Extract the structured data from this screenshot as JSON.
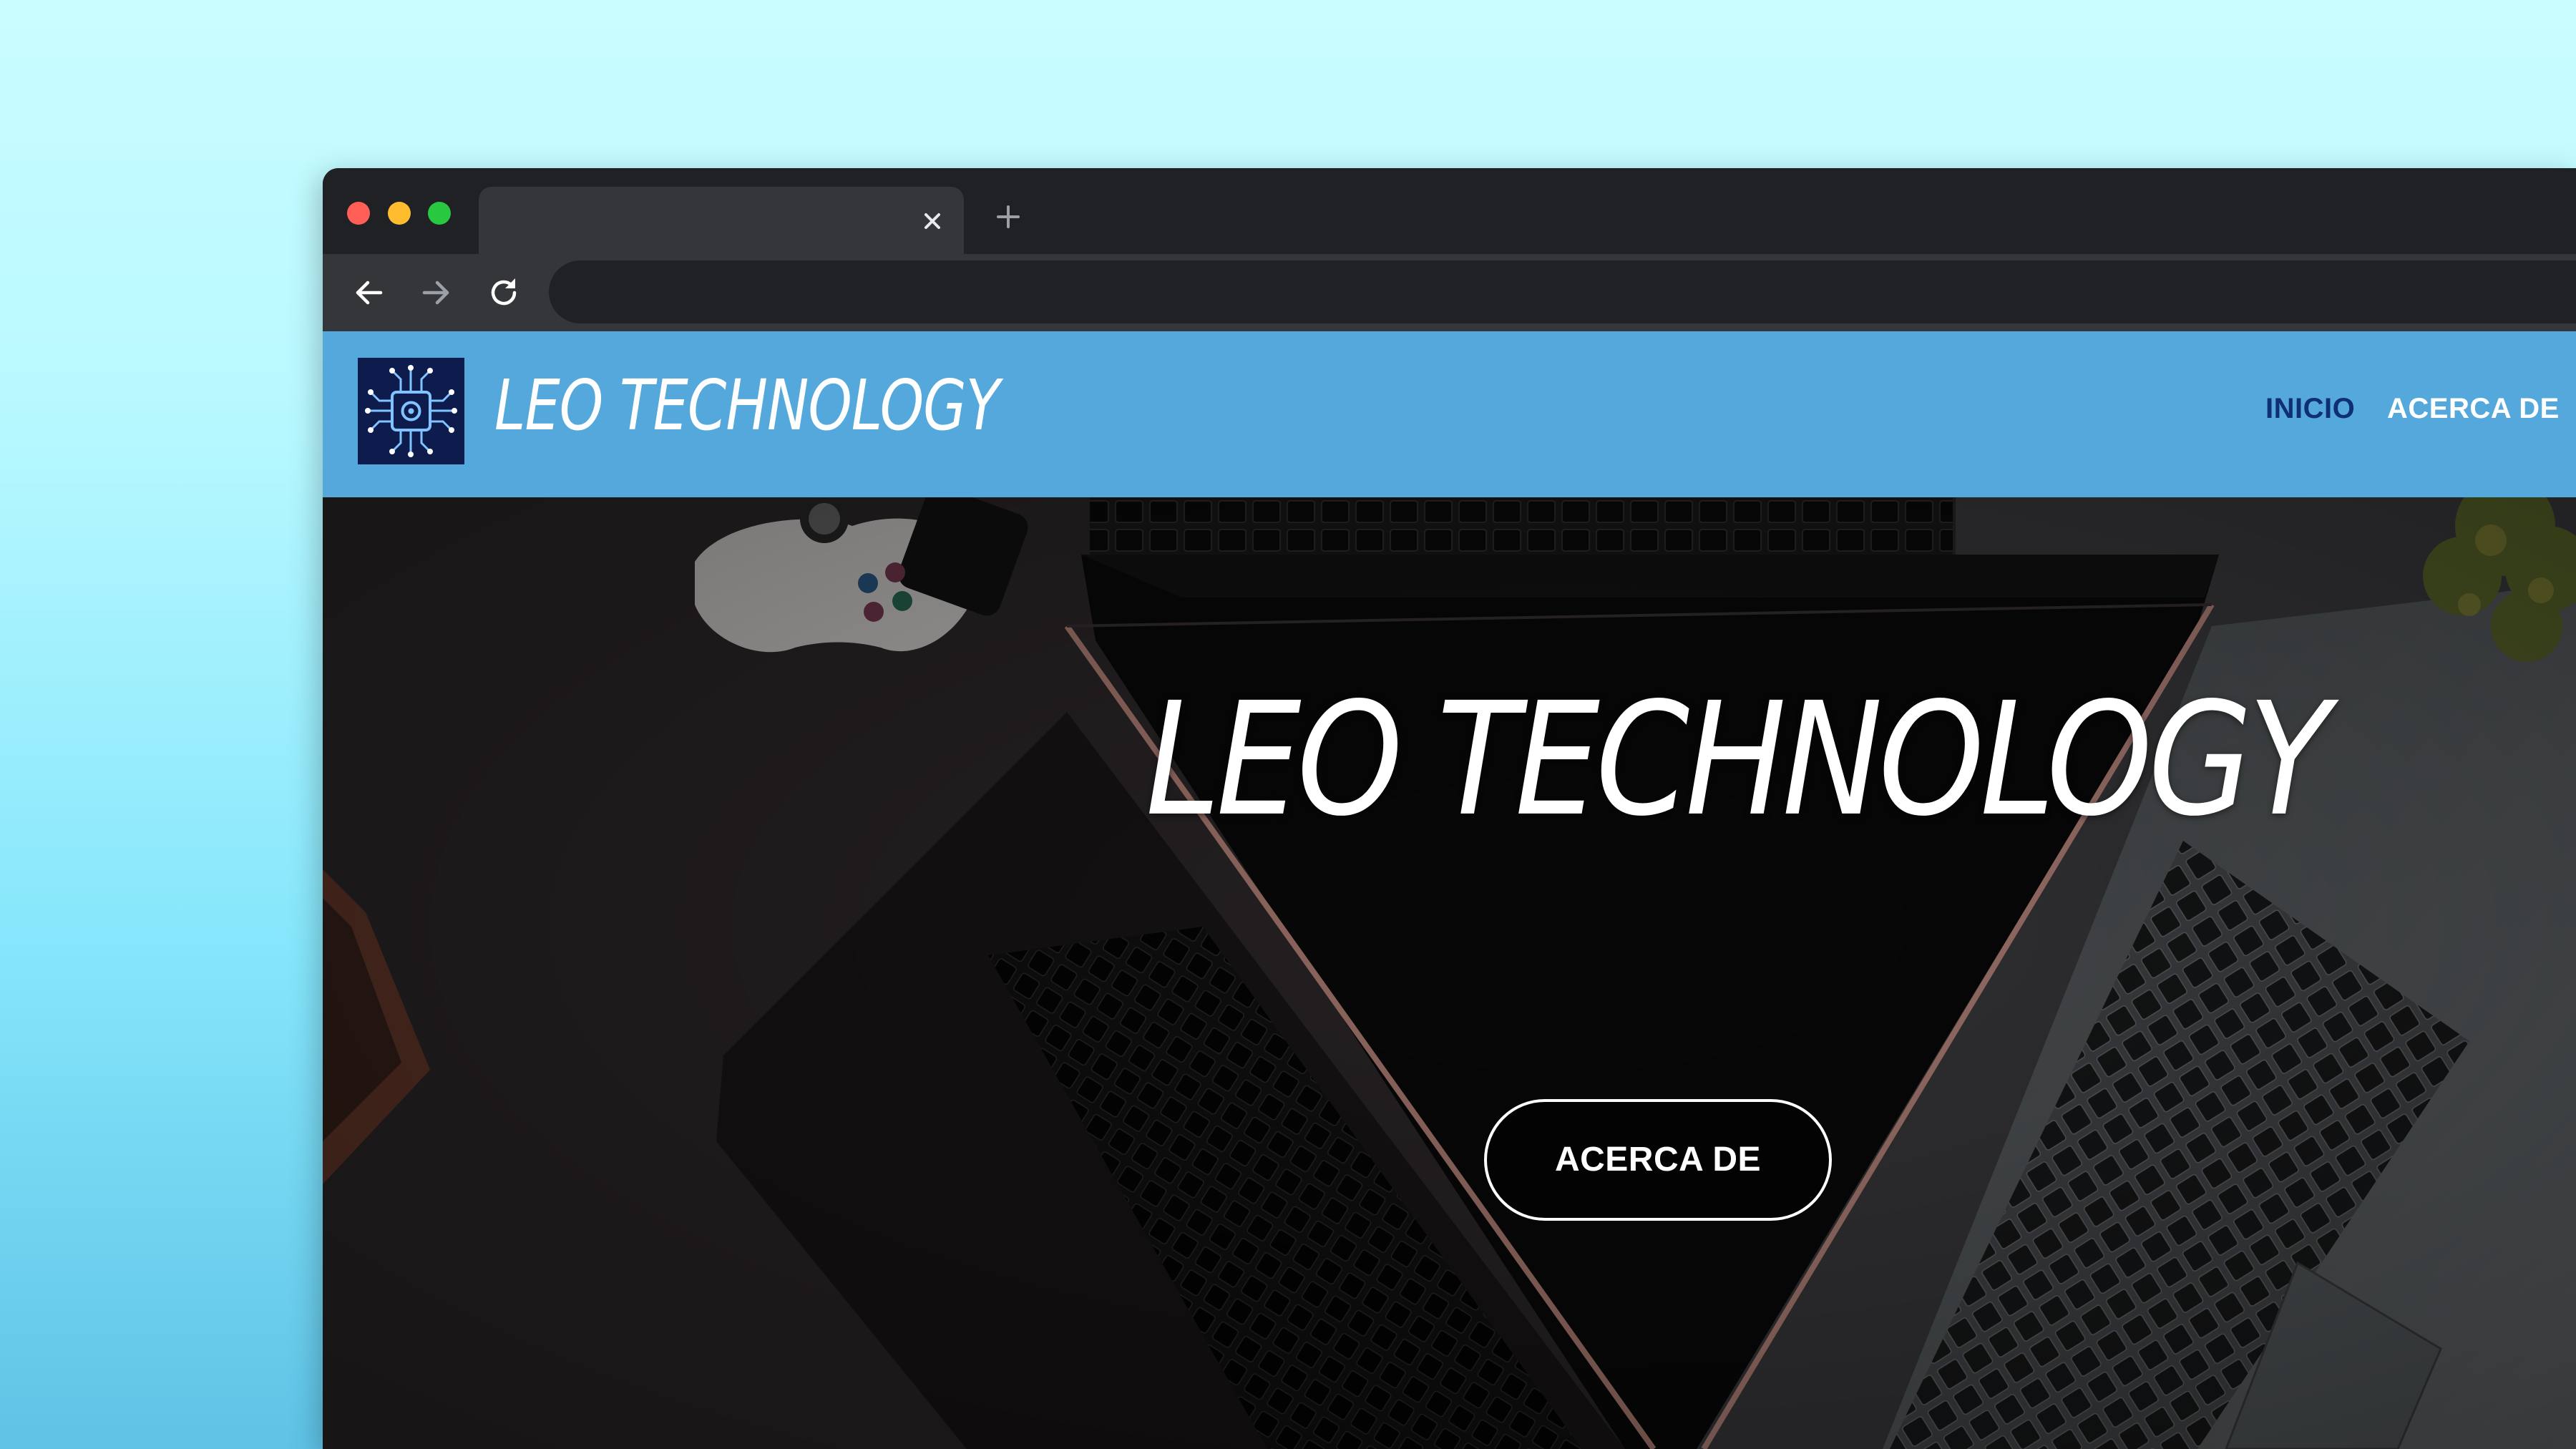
{
  "browser": {
    "tab": {
      "title": ""
    },
    "address_bar": {
      "url": ""
    },
    "icons": {
      "back": "arrow-left-icon",
      "forward": "arrow-right-icon",
      "reload": "reload-icon",
      "close_tab": "close-icon",
      "new_tab": "plus-icon"
    }
  },
  "site": {
    "brand": "LEO TECHNOLOGY",
    "logo_icon": "circuit-chip-icon",
    "nav": [
      {
        "label": "INICIO",
        "active": true
      },
      {
        "label": "ACERCA DE",
        "active": false
      }
    ],
    "hero": {
      "title": "LEO TECHNOLOGY",
      "button_label": "ACERCA DE"
    }
  },
  "colors": {
    "page_background_top": "#cafdff",
    "page_background_bottom": "#5fc3e6",
    "browser_chrome": "#202124",
    "toolbar": "#35363a",
    "site_nav": "#55a8dc",
    "nav_active": "#0e2f73",
    "nav_text": "#ffffff",
    "logo_bg": "#0d1b4d"
  }
}
